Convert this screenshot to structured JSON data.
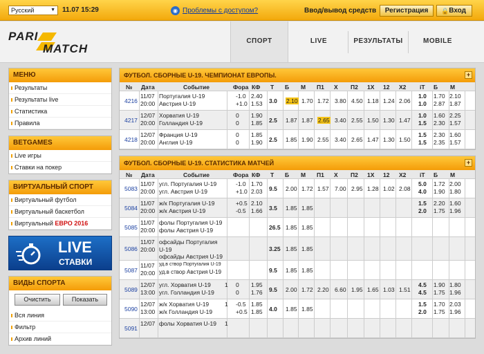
{
  "topbar": {
    "language": "Русский",
    "datetime": "11.07 15:29",
    "problems_link": "Проблемы с доступом?",
    "deposit_link": "Ввод/вывод средств",
    "register_label": "Регистрация",
    "login_label": "Вход"
  },
  "logo": {
    "line1": "PARI",
    "line2": "MATCH"
  },
  "nav": {
    "sport": "СПОРТ",
    "live": "LIVE",
    "results": "РЕЗУЛЬТАТЫ",
    "mobile": "MOBILE"
  },
  "sidebar": {
    "menu": {
      "title": "МЕНЮ",
      "items": [
        "Результаты",
        "Результаты live",
        "Статистика",
        "Правила"
      ]
    },
    "betgames": {
      "title": "BETGAMES",
      "items": [
        "Live игры",
        "Ставки на покер"
      ]
    },
    "virtual": {
      "title": "ВИРТУАЛЬНЫЙ СПОРТ",
      "items": [
        "Виртуальный футбол",
        "Виртуальный баскетбол"
      ],
      "euro_prefix": "Виртуальный ",
      "euro_highlight": "ЕВРО 2016"
    },
    "live_banner": {
      "title": "LIVE",
      "subtitle": "СТАВКИ"
    },
    "sports": {
      "title": "ВИДЫ СПОРТА",
      "clear_button": "Очистить",
      "show_button": "Показать",
      "items": [
        "Вся линия",
        "Фильтр",
        "Архив линий"
      ]
    }
  },
  "panel1": {
    "title": "ФУТБОЛ. СБОРНЫЕ U-19. ЧЕМПИОНАТ ЕВРОПЫ.",
    "headers": [
      "№",
      "Дата",
      "Событие",
      "Фора",
      "КФ",
      "Т",
      "Б",
      "М",
      "П1",
      "Х",
      "П2",
      "1Х",
      "12",
      "Х2",
      "iТ",
      "Б",
      "М"
    ],
    "rows": [
      {
        "id": "4216",
        "date1": "11/07",
        "date2": "20:00",
        "team1": "Португалия U-19",
        "team2": "Австрия U-19",
        "fora1": "-1.0",
        "fora2": "+1.0",
        "kf1": "2.40",
        "kf2": "1.53",
        "t": "3.0",
        "b": "2.10",
        "m": "1.70",
        "p1": "1.72",
        "x": "3.80",
        "p2": "4.50",
        "x1": "1.18",
        "x12": "1.24",
        "x2": "2.06",
        "it1": "1.0",
        "it2": "1.0",
        "ib1": "1.70",
        "ib2": "2.87",
        "im1": "2.10",
        "im2": "1.87"
      },
      {
        "id": "4217",
        "date1": "12/07",
        "date2": "20:00",
        "team1": "Хорватия U-19",
        "team2": "Голландия U-19",
        "fora1": "0",
        "fora2": "0",
        "kf1": "1.90",
        "kf2": "1.85",
        "t": "2.5",
        "b": "1.87",
        "m": "1.87",
        "p1": "2.65",
        "x": "3.40",
        "p2": "2.55",
        "x1": "1.50",
        "x12": "1.30",
        "x2": "1.47",
        "it1": "1.0",
        "it2": "1.5",
        "ib1": "1.60",
        "ib2": "2.30",
        "im1": "2.25",
        "im2": "1.57"
      },
      {
        "id": "4218",
        "date1": "12/07",
        "date2": "20:00",
        "team1": "Франция U-19",
        "team2": "Англия U-19",
        "fora1": "0",
        "fora2": "0",
        "kf1": "1.85",
        "kf2": "1.90",
        "t": "2.5",
        "b": "1.85",
        "m": "1.90",
        "p1": "2.55",
        "x": "3.40",
        "p2": "2.65",
        "x1": "1.47",
        "x12": "1.30",
        "x2": "1.50",
        "it1": "1.5",
        "it2": "1.5",
        "ib1": "2.30",
        "ib2": "2.35",
        "im1": "1.60",
        "im2": "1.57"
      }
    ]
  },
  "panel2": {
    "title": "ФУТБОЛ. СБОРНЫЕ U-19. СТАТИСТИКА МАТЧЕЙ",
    "headers": [
      "№",
      "Дата",
      "Событие",
      "Фора",
      "КФ",
      "Т",
      "Б",
      "М",
      "П1",
      "Х",
      "П2",
      "1Х",
      "12",
      "Х2",
      "iТ",
      "Б",
      "М"
    ],
    "rows": [
      {
        "id": "5083",
        "date1": "11/07",
        "date2": "20:00",
        "team1": "угл. Португалия U-19",
        "team2": "угл. Австрия U-19",
        "fora1": "-1.0",
        "fora2": "+1.0",
        "kf1": "1.70",
        "kf2": "2.03",
        "t": "9.5",
        "b": "2.00",
        "m": "1.72",
        "p1": "1.57",
        "x": "7.00",
        "p2": "2.95",
        "x1": "1.28",
        "x12": "1.02",
        "x2": "2.08",
        "it1": "5.0",
        "it2": "4.0",
        "ib1": "1.72",
        "ib2": "1.90",
        "im1": "2.00",
        "im2": "1.80"
      },
      {
        "id": "5084",
        "date1": "11/07",
        "date2": "20:00",
        "team1": "ж/к Португалия U-19",
        "team2": "ж/к Австрия U-19",
        "fora1": "+0.5",
        "fora2": "-0.5",
        "kf1": "2.10",
        "kf2": "1.66",
        "t": "3.5",
        "b": "1.85",
        "m": "1.85",
        "p1": "",
        "x": "",
        "p2": "",
        "x1": "",
        "x12": "",
        "x2": "",
        "it1": "1.5",
        "it2": "2.0",
        "ib1": "2.20",
        "ib2": "1.75",
        "im1": "1.60",
        "im2": "1.96"
      },
      {
        "id": "5085",
        "date1": "11/07",
        "date2": "20:00",
        "team1": "фолы Португалия U-19",
        "team2": "фолы Австрия U-19",
        "fora1": "",
        "fora2": "",
        "kf1": "",
        "kf2": "",
        "t": "26.5",
        "b": "1.85",
        "m": "1.85",
        "p1": "",
        "x": "",
        "p2": "",
        "x1": "",
        "x12": "",
        "x2": "",
        "it1": "",
        "it2": "",
        "ib1": "",
        "ib2": "",
        "im1": "",
        "im2": ""
      },
      {
        "id": "5086",
        "date1": "11/07",
        "date2": "20:00",
        "team1": "офсайды Португалия",
        "team2": "U-19",
        "team3": "офсайды Австрия U-19",
        "fora1": "",
        "fora2": "",
        "kf1": "",
        "kf2": "",
        "t": "3.25",
        "b": "1.85",
        "m": "1.85",
        "p1": "",
        "x": "",
        "p2": "",
        "x1": "",
        "x12": "",
        "x2": "",
        "it1": "",
        "it2": "",
        "ib1": "",
        "ib2": "",
        "im1": "",
        "im2": ""
      },
      {
        "id": "5087",
        "date1": "11/07",
        "date2": "20:00",
        "team1": "уд.в створ Португалия U-19",
        "team2": "уд.в створ Австрия U-19",
        "fora1": "",
        "fora2": "",
        "kf1": "",
        "kf2": "",
        "t": "9.5",
        "b": "1.85",
        "m": "1.85",
        "p1": "",
        "x": "",
        "p2": "",
        "x1": "",
        "x12": "",
        "x2": "",
        "it1": "",
        "it2": "",
        "ib1": "",
        "ib2": "",
        "im1": "",
        "im2": ""
      },
      {
        "id": "5089",
        "date1": "12/07",
        "date2": "13:00",
        "team1": "угл. Хорватия U-19",
        "team2": "угл. Голландия U-19",
        "mark": "1",
        "fora1": "0",
        "fora2": "0",
        "kf1": "1.95",
        "kf2": "1.76",
        "t": "9.5",
        "b": "2.00",
        "m": "1.72",
        "p1": "2.20",
        "x": "6.60",
        "p2": "1.95",
        "x1": "1.65",
        "x12": "1.03",
        "x2": "1.51",
        "it1": "4.5",
        "it2": "4.5",
        "ib1": "1.90",
        "ib2": "1.75",
        "im1": "1.80",
        "im2": "1.96"
      },
      {
        "id": "5090",
        "date1": "12/07",
        "date2": "13:00",
        "team1": "ж/к Хорватия U-19",
        "team2": "ж/к Голландия U-19",
        "mark": "1",
        "fora1": "-0.5",
        "fora2": "+0.5",
        "kf1": "1.85",
        "kf2": "1.85",
        "t": "4.0",
        "b": "1.85",
        "m": "1.85",
        "p1": "",
        "x": "",
        "p2": "",
        "x1": "",
        "x12": "",
        "x2": "",
        "it1": "1.5",
        "it2": "2.0",
        "ib1": "1.70",
        "ib2": "1.75",
        "im1": "2.03",
        "im2": "1.96"
      },
      {
        "id": "5091",
        "date1": "12/07",
        "date2": "",
        "team1": "фолы Хорватия U-19",
        "team2": "",
        "mark": "1",
        "fora1": "",
        "fora2": "",
        "kf1": "",
        "kf2": "",
        "t": "",
        "b": "",
        "m": "",
        "p1": "",
        "x": "",
        "p2": "",
        "x1": "",
        "x12": "",
        "x2": "",
        "it1": "",
        "it2": "",
        "ib1": "",
        "ib2": "",
        "im1": "",
        "im2": ""
      }
    ]
  }
}
